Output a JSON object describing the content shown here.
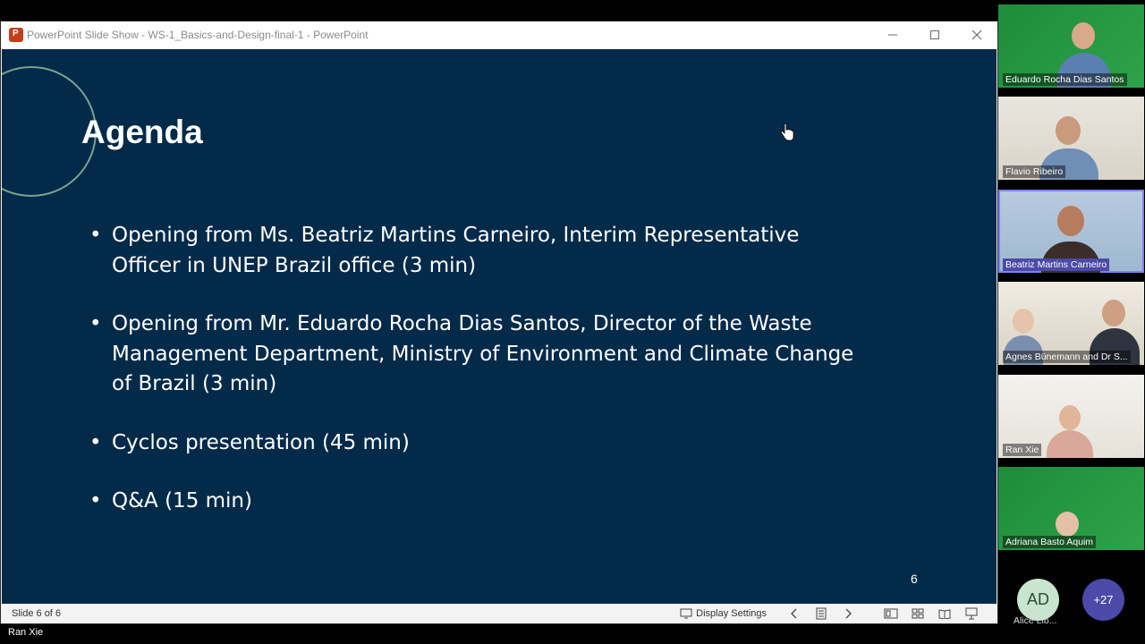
{
  "window": {
    "title": "PowerPoint Slide Show  -  WS-1_Basics-and-Design-final-1  -  PowerPoint",
    "controls": [
      "minimize",
      "maximize",
      "close"
    ]
  },
  "slide": {
    "title": "Agenda",
    "bullets": [
      "Opening from Ms. Beatriz Martins Carneiro, Interim Representative Officer in UNEP Brazil office (3 min)",
      "Opening from Mr. Eduardo Rocha Dias Santos, Director of the Waste Management Department, Ministry of Environment and Climate Change of Brazil (3 min)",
      "Cyclos presentation (45 min)",
      "Q&A (15 min)"
    ],
    "number": "6",
    "background_color": "#042a4a"
  },
  "statusbar": {
    "slide_count": "Slide 6 of 6",
    "display_settings": "Display Settings"
  },
  "meeting": {
    "bottom_name": "Ran Xie",
    "participants": [
      {
        "name": "Eduardo Rocha Dias Santos"
      },
      {
        "name": "Flavio Ribeiro"
      },
      {
        "name": "Beatriz Martins Carneiro",
        "active": true
      },
      {
        "name": "Agnes Bünemann and Dr S..."
      },
      {
        "name": "Ran Xie"
      },
      {
        "name": "Adriana Basto Aquim"
      }
    ],
    "avatar_initials": "AD",
    "avatar_name": "Alice Lib...",
    "more_count": "+27",
    "accent_color": "#7b83eb"
  }
}
